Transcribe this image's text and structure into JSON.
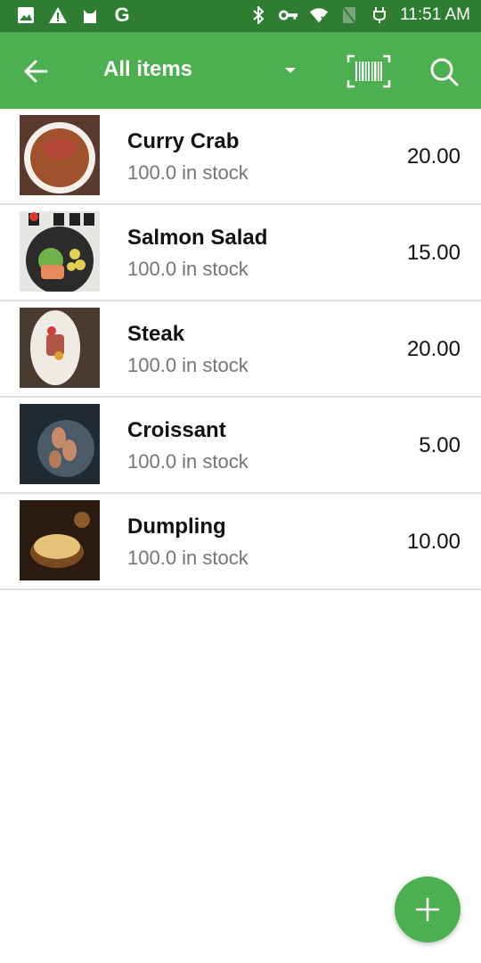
{
  "status_bar": {
    "time": "11:51 AM",
    "left_icons": [
      "image-icon",
      "warning-icon",
      "cat-icon",
      "google-icon"
    ],
    "right_icons": [
      "bluetooth-icon",
      "vpn-key-icon",
      "wifi-off-icon",
      "no-sim-icon",
      "battery-charging-icon"
    ]
  },
  "toolbar": {
    "title": "All items",
    "back_icon": "arrow-left-icon",
    "dropdown_icon": "dropdown-icon",
    "barcode_icon": "barcode-scan-icon",
    "search_icon": "search-icon",
    "color": "#4caf50"
  },
  "items": [
    {
      "name": "Curry Crab",
      "stock": "100.0 in stock",
      "price": "20.00",
      "colors": [
        "#5a3a2e",
        "#a0522d",
        "#f5f0ea"
      ]
    },
    {
      "name": "Salmon Salad",
      "stock": "100.0 in stock",
      "price": "15.00",
      "colors": [
        "#e8e6e2",
        "#2b2b2b",
        "#e98a5a"
      ]
    },
    {
      "name": "Steak",
      "stock": "100.0 in stock",
      "price": "20.00",
      "colors": [
        "#4a3a30",
        "#efeae4",
        "#b3564a"
      ]
    },
    {
      "name": "Croissant",
      "stock": "100.0 in stock",
      "price": "5.00",
      "colors": [
        "#1f2a33",
        "#4a5a66",
        "#c68a6a"
      ]
    },
    {
      "name": "Dumpling",
      "stock": "100.0 in stock",
      "price": "10.00",
      "colors": [
        "#2a1a10",
        "#7a4a20",
        "#e5c27a"
      ]
    }
  ],
  "fab": {
    "icon": "plus-icon",
    "label": "Add item"
  }
}
